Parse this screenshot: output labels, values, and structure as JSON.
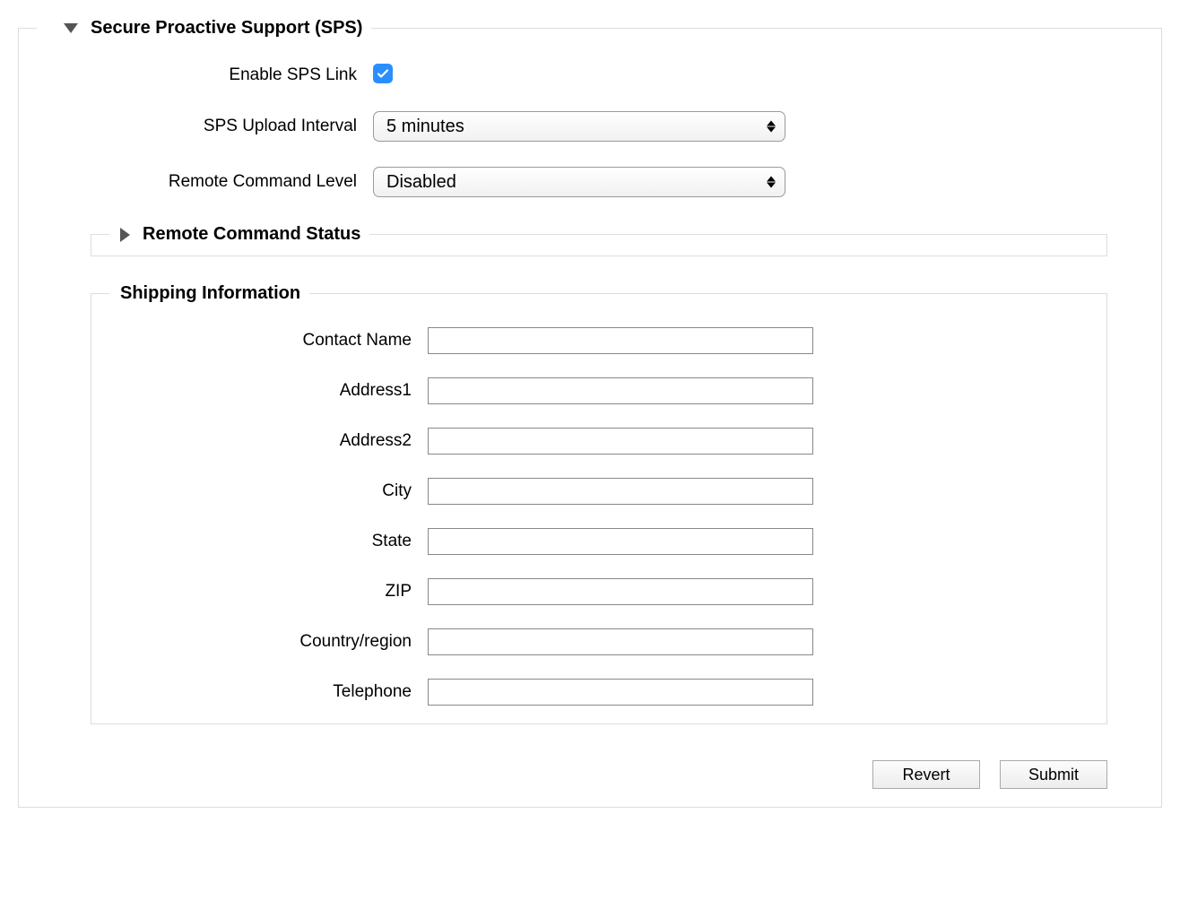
{
  "section": {
    "title": "Secure Proactive Support (SPS)",
    "enable_label": "Enable SPS Link",
    "enable_checked": true,
    "upload_interval_label": "SPS Upload Interval",
    "upload_interval_value": "5 minutes",
    "remote_level_label": "Remote Command Level",
    "remote_level_value": "Disabled",
    "remote_status_title": "Remote Command Status"
  },
  "shipping": {
    "title": "Shipping Information",
    "fields": [
      {
        "label": "Contact Name",
        "value": ""
      },
      {
        "label": "Address1",
        "value": ""
      },
      {
        "label": "Address2",
        "value": ""
      },
      {
        "label": "City",
        "value": ""
      },
      {
        "label": "State",
        "value": ""
      },
      {
        "label": "ZIP",
        "value": ""
      },
      {
        "label": "Country/region",
        "value": ""
      },
      {
        "label": "Telephone",
        "value": ""
      }
    ]
  },
  "buttons": {
    "revert": "Revert",
    "submit": "Submit"
  }
}
